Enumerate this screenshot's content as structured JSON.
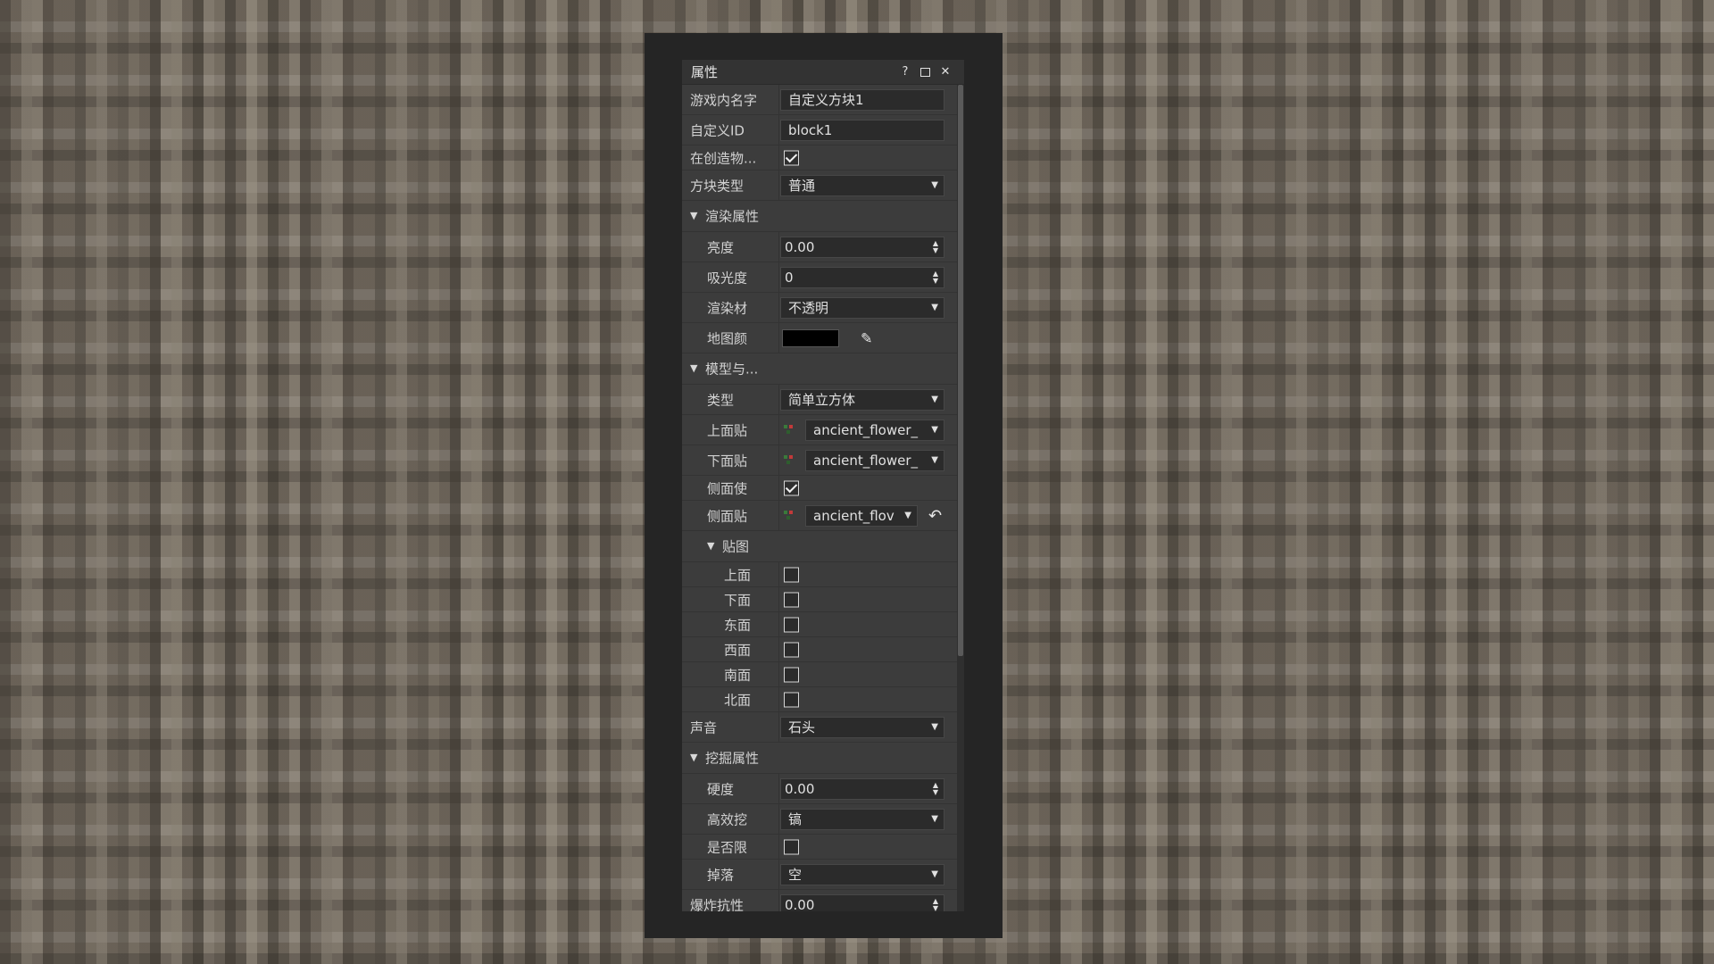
{
  "window": {
    "title": "属性",
    "help": "?",
    "close": "✕"
  },
  "basic": {
    "name_label": "游戏内名字",
    "name_value": "自定义方块1",
    "id_label": "自定义ID",
    "id_value": "block1",
    "creative_label": "在创造物...",
    "creative_checked": true,
    "type_label": "方块类型",
    "type_value": "普通"
  },
  "render": {
    "section": "渲染属性",
    "brightness_label": "亮度",
    "brightness_value": "0.00",
    "absorb_label": "吸光度",
    "absorb_value": "0",
    "material_label": "渲染材",
    "material_value": "不透明",
    "mapcolor_label": "地图颜",
    "mapcolor": "#000000"
  },
  "model": {
    "section": "模型与...",
    "type_label": "类型",
    "type_value": "简单立方体",
    "top_label": "上面贴",
    "top_value": "ancient_flower_",
    "bottom_label": "下面贴",
    "bottom_value": "ancient_flower_",
    "side_use_label": "侧面使",
    "side_use_checked": true,
    "side_label": "侧面贴",
    "side_value": "ancient_flov",
    "tex_section": "贴图",
    "faces": [
      {
        "label": "上面",
        "checked": false
      },
      {
        "label": "下面",
        "checked": false
      },
      {
        "label": "东面",
        "checked": false
      },
      {
        "label": "西面",
        "checked": false
      },
      {
        "label": "南面",
        "checked": false
      },
      {
        "label": "北面",
        "checked": false
      }
    ],
    "sound_label": "声音",
    "sound_value": "石头"
  },
  "mining": {
    "section": "挖掘属性",
    "hardness_label": "硬度",
    "hardness_value": "0.00",
    "tool_label": "高效挖",
    "tool_value": "镐",
    "limit_label": "是否限",
    "limit_checked": false,
    "drop_label": "掉落",
    "drop_value": "空",
    "explosion_label": "爆炸抗性",
    "explosion_value": "0.00"
  }
}
